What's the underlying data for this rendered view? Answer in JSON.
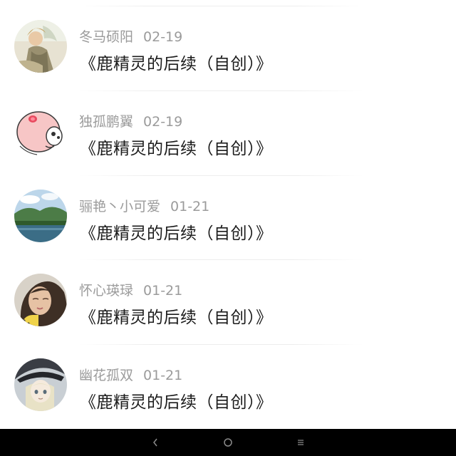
{
  "comments": [
    {
      "name": "冬马硕阳",
      "date": "02-19",
      "title": "《鹿精灵的后续（自创）》",
      "avatar": "avatar-illustrated-figure"
    },
    {
      "name": "独孤鹏翼",
      "date": "02-19",
      "title": "《鹿精灵的后续（自创）》",
      "avatar": "avatar-pink-cartoon-pig"
    },
    {
      "name": "骊艳丶小可爱",
      "date": "01-21",
      "title": "《鹿精灵的后续（自创）》",
      "avatar": "avatar-lake-landscape"
    },
    {
      "name": "怀心瑛琭",
      "date": "01-21",
      "title": "《鹿精灵的后续（自创）》",
      "avatar": "avatar-woman-photo"
    },
    {
      "name": "幽花孤双",
      "date": "01-21",
      "title": "《鹿精灵的后续（自创）》",
      "avatar": "avatar-anime-character"
    }
  ],
  "navbar": {
    "back": "back-icon",
    "home": "home-icon",
    "menu": "menu-icon"
  },
  "colors": {
    "name_text": "#9b9b9b",
    "title_text": "#1c1c1c",
    "navbar_bg": "#000000"
  }
}
